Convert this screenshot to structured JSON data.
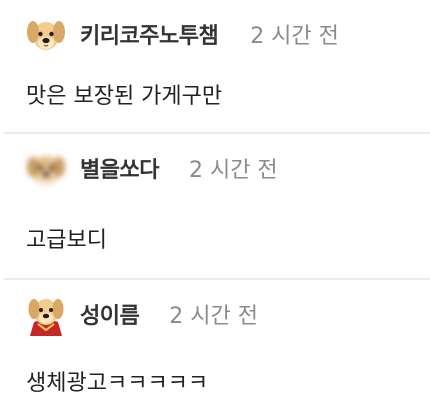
{
  "comments": [
    {
      "author": "키리코주노투챔",
      "time": "2 시간 전",
      "text": "맛은 보장된 가게구만",
      "avatar_icon": "puppy-avatar-icon"
    },
    {
      "author": "별을쏘다",
      "time": "2 시간 전",
      "text": "고급보디",
      "avatar_icon": "blurred-puppy-avatar-icon"
    },
    {
      "author": "성이름",
      "time": "2 시간 전",
      "text": "생체광고ㅋㅋㅋㅋㅋ",
      "avatar_icon": "puppy-red-cape-avatar-icon"
    }
  ],
  "colors": {
    "author": "#333333",
    "time": "#8a8a8a",
    "text": "#222222",
    "divider": "#ededed",
    "puppy_fur": "#f0c98a",
    "cape": "#c62828"
  }
}
